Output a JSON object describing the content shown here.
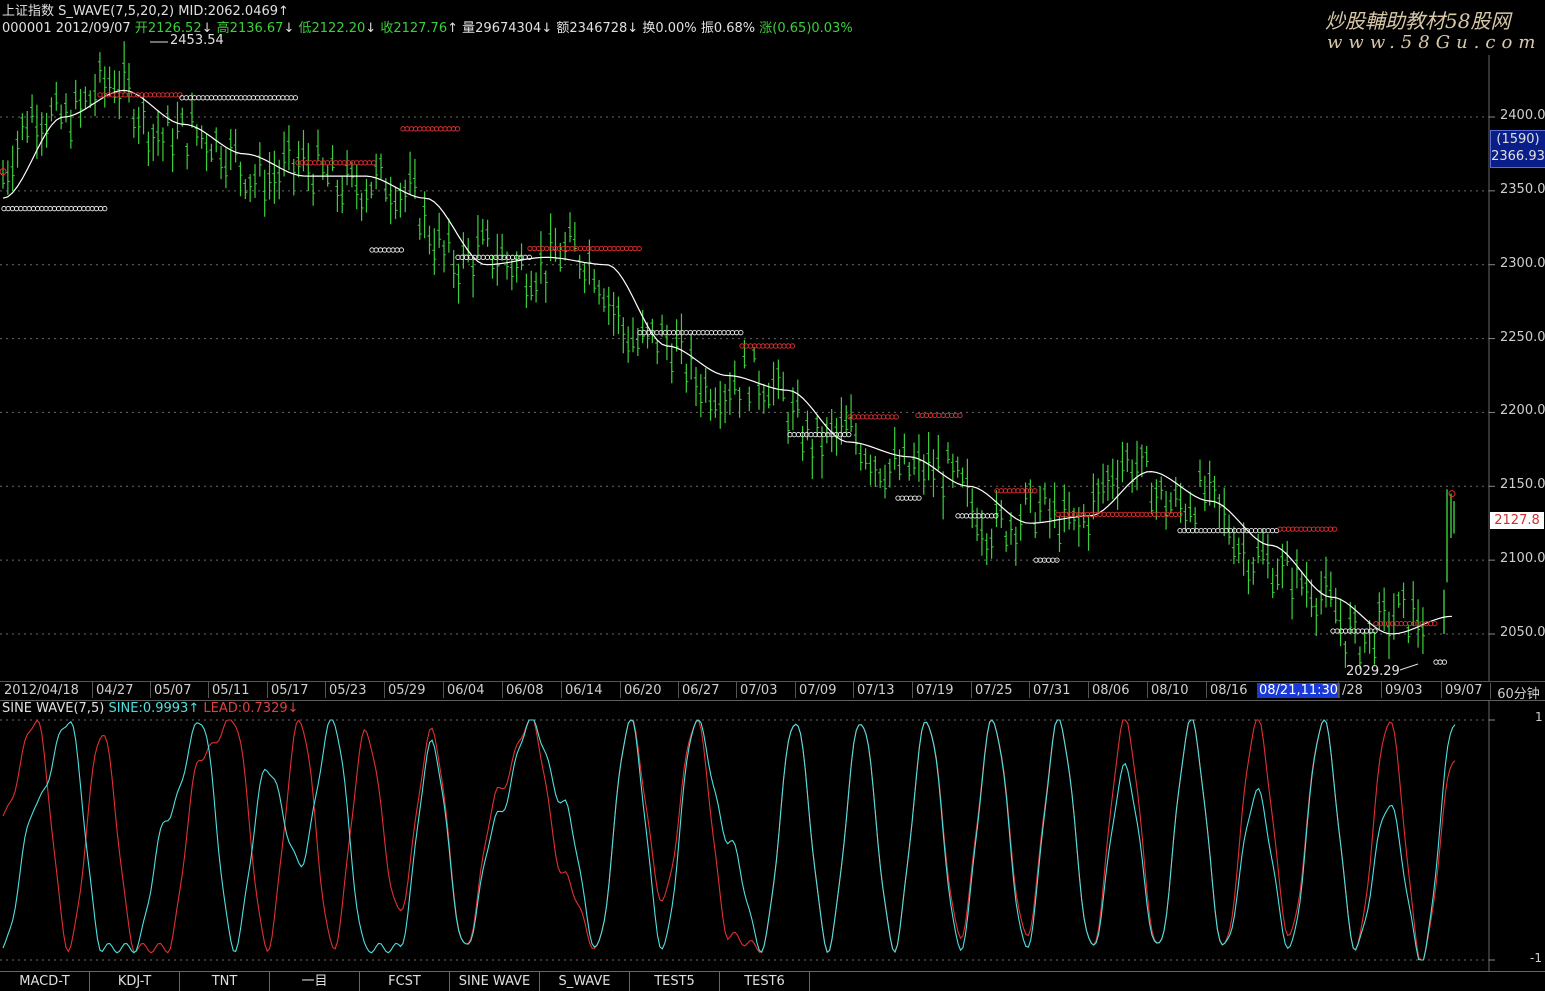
{
  "header": {
    "line1_name": "上证指数",
    "line1_indicator": "S_WAVE(7,5,20,2)",
    "line1_mid": "MID:2062.0469",
    "line1_mid_arrow": "↑",
    "code_date": "000001 2012/09/07",
    "open_label": "开",
    "open_val": "2126.52",
    "open_arrow": "↓",
    "high_label": "高",
    "high_val": "2136.67",
    "high_arrow": "↓",
    "low_label": "低",
    "low_val": "2122.20",
    "low_arrow": "↓",
    "close_label": "收",
    "close_val": "2127.76",
    "close_arrow": "↑",
    "vol_label": "量",
    "vol_val": "29674304",
    "vol_arrow": "↓",
    "amt_label": "额",
    "amt_val": "2346728",
    "amt_arrow": "↓",
    "turn_label": "换",
    "turn_val": "0.00%",
    "amp_label": "振",
    "amp_val": "0.68%",
    "chg_label": "涨",
    "chg_val": "(0.65)0.03%"
  },
  "watermark": {
    "line1": "炒股輔助教材58股网",
    "line2": "www.58Gu.com"
  },
  "y_axis": {
    "ticks": [
      "2400.0",
      "2350.0",
      "2300.0",
      "2250.0",
      "2200.0",
      "2150.0",
      "2100.0",
      "2050.0"
    ]
  },
  "price_box": {
    "count": "(1590)",
    "value": "2366.93"
  },
  "last_price": "2127.8",
  "annotations": {
    "high": "2453.54",
    "low": "2029.29"
  },
  "date_axis": {
    "labels": [
      "2012/04/18",
      "04/27",
      "05/07",
      "05/11",
      "05/17",
      "05/23",
      "05/29",
      "06/04",
      "06/08",
      "06/14",
      "06/20",
      "06/27",
      "07/03",
      "07/09",
      "07/13",
      "07/19",
      "07/25",
      "07/31",
      "08/06",
      "08/10",
      "08/16",
      "08/21,11:30",
      "/28",
      "09/03",
      "09/07"
    ],
    "period": "60分钟"
  },
  "indicator": {
    "name": "SINE WAVE(7,5)",
    "sine_label": "SINE:0.9993",
    "sine_arrow": "↑",
    "lead_label": "LEAD:0.7329",
    "lead_arrow": "↓",
    "top_tick": "1",
    "bottom_tick": "-1"
  },
  "tabs": [
    "MACD-T",
    "KDJ-T",
    "TNT",
    "一目",
    "FCST",
    "SINE WAVE",
    "S_WAVE",
    "TEST5",
    "TEST6"
  ],
  "colors": {
    "up": "#e04040",
    "down": "#3ccf3c",
    "sine": "#4fe0e0",
    "lead": "#e03030",
    "ma": "#ffffff",
    "grid": "#6a6a6a"
  },
  "chart_data": [
    {
      "type": "line",
      "title": "上证指数 S_WAVE(7,5,20,2)",
      "x": [
        "2012/04/18",
        "04/27",
        "05/07",
        "05/11",
        "05/17",
        "05/23",
        "05/29",
        "06/04",
        "06/08",
        "06/14",
        "06/20",
        "06/27",
        "07/03",
        "07/09",
        "07/13",
        "07/19",
        "07/25",
        "07/31",
        "08/06",
        "08/10",
        "08/16",
        "08/21",
        "08/28",
        "09/03",
        "09/07"
      ],
      "series": [
        {
          "name": "MID",
          "values": [
            2345,
            2400,
            2418,
            2395,
            2375,
            2360,
            2360,
            2345,
            2300,
            2305,
            2300,
            2245,
            2225,
            2215,
            2180,
            2170,
            2150,
            2125,
            2130,
            2160,
            2140,
            2110,
            2075,
            2050,
            2062
          ]
        }
      ],
      "ylim": [
        2020,
        2470
      ],
      "yticks": [
        2050,
        2100,
        2150,
        2200,
        2250,
        2300,
        2350,
        2400
      ],
      "high": 2453.54,
      "low": 2029.29,
      "last": 2127.8
    },
    {
      "type": "line",
      "title": "SINE WAVE(7,5)",
      "ylim": [
        -1,
        1
      ],
      "series": [
        {
          "name": "SINE",
          "values": [
            -0.9,
            0.3,
            1.0,
            -0.9,
            -0.9,
            0.2,
            1.0,
            -0.9,
            0.6,
            -0.2,
            1.0,
            -0.9,
            -0.9,
            0.8,
            -0.9,
            0.2,
            1.0,
            0.3,
            -0.9,
            1.0,
            -0.9,
            1.0,
            0.0,
            -0.9,
            1.0,
            -0.9,
            1.0,
            -0.9,
            1.0,
            -0.9,
            1.0,
            -0.9,
            1.0,
            -0.9,
            0.6,
            -0.9,
            1.0,
            -0.9,
            0.4,
            -0.9,
            1.0,
            -0.9,
            0.3,
            -1.0,
            1.0
          ]
        },
        {
          "name": "LEAD",
          "values": [
            0.2,
            1.0,
            -0.9,
            0.9,
            -0.9,
            -0.9,
            0.7,
            1.0,
            -0.9,
            1.0,
            -0.9,
            0.9,
            -0.6,
            0.9,
            -0.9,
            0.4,
            1.0,
            -0.3,
            -0.9,
            1.0,
            -0.5,
            1.0,
            -0.8,
            -0.9,
            1.0,
            -0.9,
            1.0,
            -0.9,
            1.0,
            -0.8,
            1.0,
            -0.8,
            1.0,
            -0.9,
            1.0,
            -0.9,
            1.0,
            -0.9,
            1.0,
            -0.8,
            1.0,
            -0.9,
            1.0,
            -1.0,
            0.7
          ]
        }
      ]
    }
  ]
}
